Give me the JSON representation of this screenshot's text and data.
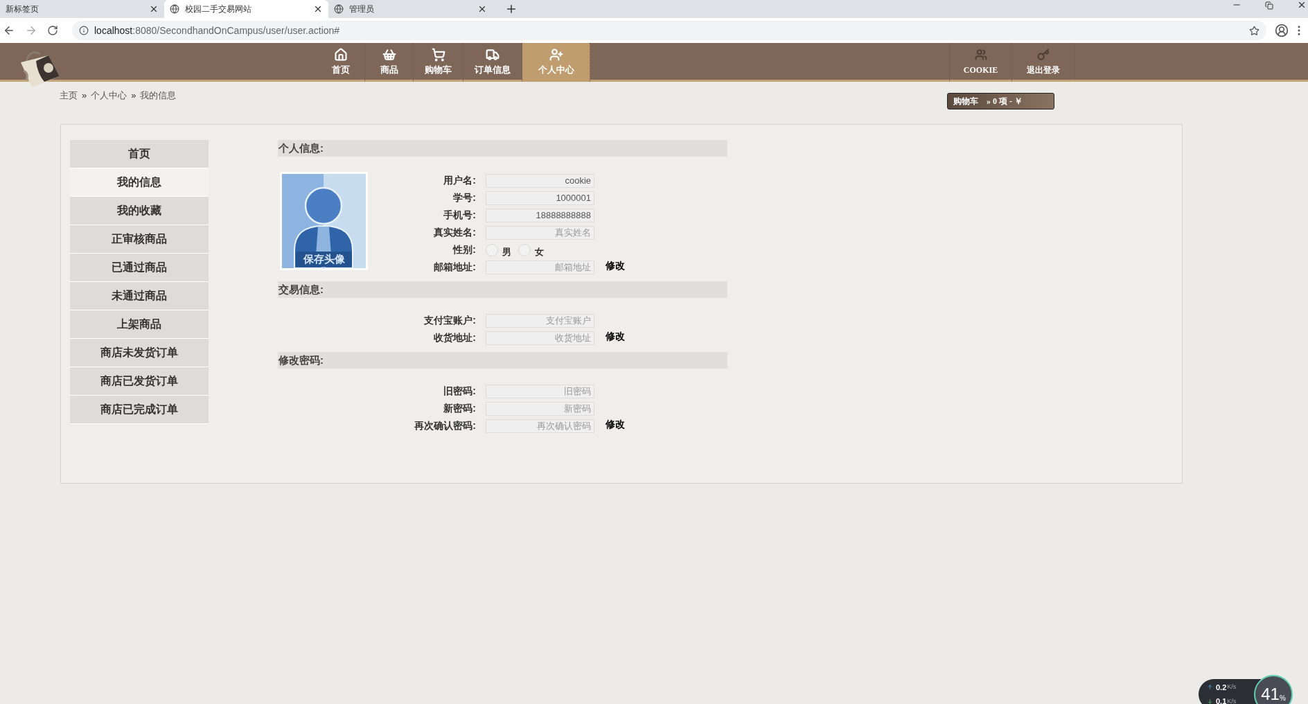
{
  "browser": {
    "tabs": [
      {
        "title": "新标签页",
        "selected": false,
        "globe": false
      },
      {
        "title": "校园二手交易网站",
        "selected": true,
        "globe": true
      },
      {
        "title": "管理员",
        "selected": false,
        "globe": true
      }
    ],
    "url": {
      "host": "localhost",
      "path": ":8080/SecondhandOnCampus/user/user.action#"
    }
  },
  "nav": {
    "items": [
      {
        "label": "首页",
        "kind": "home",
        "selected": false
      },
      {
        "label": "商品",
        "kind": "basket",
        "selected": false
      },
      {
        "label": "购物车",
        "kind": "cart",
        "selected": false
      },
      {
        "label": "订单信息",
        "kind": "truck",
        "selected": false
      },
      {
        "label": "个人中心",
        "kind": "user",
        "selected": true
      }
    ],
    "right_items": [
      {
        "label": "COOKIE",
        "kind": "group"
      },
      {
        "label": "退出登录",
        "kind": "key"
      }
    ]
  },
  "breadcrumb": {
    "separator": "»",
    "items": [
      "主页",
      "个人中心",
      "我的信息"
    ]
  },
  "cart_summary": {
    "label": "购物车",
    "text": "» 0 项 - ￥"
  },
  "sidebar": {
    "items": [
      {
        "label": "首页",
        "selected": false
      },
      {
        "label": "我的信息",
        "selected": true
      },
      {
        "label": "我的收藏",
        "selected": false
      },
      {
        "label": "正审核商品",
        "selected": false
      },
      {
        "label": "已通过商品",
        "selected": false
      },
      {
        "label": "未通过商品",
        "selected": false
      },
      {
        "label": "上架商品",
        "selected": false
      },
      {
        "label": "商店未发货订单",
        "selected": false
      },
      {
        "label": "商店已发货订单",
        "selected": false
      },
      {
        "label": "商店已完成订单",
        "selected": false
      }
    ]
  },
  "sections": [
    {
      "title": "个人信息:",
      "avatar": {
        "caption": "保存头像"
      },
      "action": "修改",
      "fields": [
        {
          "kind": "text",
          "label": "用户名:",
          "value": "cookie"
        },
        {
          "kind": "text",
          "label": "学号:",
          "value": "1000001"
        },
        {
          "kind": "text",
          "label": "手机号:",
          "value": "18888888888"
        },
        {
          "kind": "text",
          "label": "真实姓名:",
          "placeholder": "真实姓名"
        },
        {
          "kind": "radio",
          "label": "性别:",
          "options": [
            {
              "label": "男",
              "selected": false
            },
            {
              "label": "女",
              "selected": false
            }
          ]
        },
        {
          "kind": "text",
          "label": "邮箱地址:",
          "placeholder": "邮箱地址"
        }
      ]
    },
    {
      "title": "交易信息:",
      "action": "修改",
      "fields": [
        {
          "kind": "text",
          "label": "支付宝账户:",
          "placeholder": "支付宝账户"
        },
        {
          "kind": "text",
          "label": "收货地址:",
          "placeholder": "收货地址"
        }
      ]
    },
    {
      "title": "修改密码:",
      "action": "修改",
      "fields": [
        {
          "kind": "text",
          "label": "旧密码:",
          "placeholder": "旧密码"
        },
        {
          "kind": "text",
          "label": "新密码:",
          "placeholder": "新密码"
        },
        {
          "kind": "text",
          "label": "再次确认密码:",
          "placeholder": "再次确认密码"
        }
      ]
    }
  ],
  "net_widget": {
    "up": "0.2",
    "up_unit": "K/s",
    "down": "0.1",
    "down_unit": "K/s",
    "percent": "41",
    "percent_sign": "%"
  }
}
